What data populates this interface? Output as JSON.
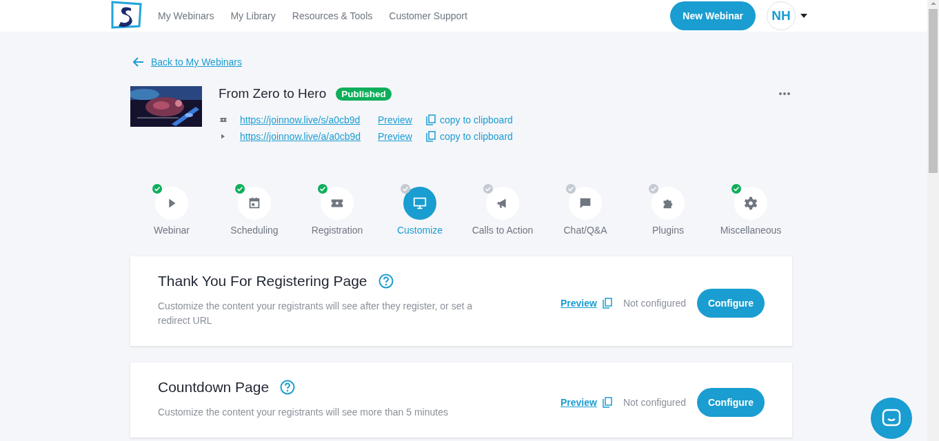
{
  "header": {
    "nav": [
      {
        "label": "My Webinars"
      },
      {
        "label": "My Library"
      },
      {
        "label": "Resources & Tools"
      },
      {
        "label": "Customer Support"
      }
    ],
    "new_button": "New Webinar",
    "avatar": "NH"
  },
  "back_link": "Back to My Webinars",
  "webinar": {
    "title": "From Zero to Hero",
    "status": "Published",
    "links": [
      {
        "kind": "registration",
        "url": "https://joinnow.live/s/a0cb9d",
        "preview": "Preview",
        "copy": "copy to clipboard"
      },
      {
        "kind": "attendee",
        "url": "https://joinnow.live/a/a0cb9d",
        "preview": "Preview",
        "copy": "copy to clipboard"
      }
    ]
  },
  "steps": [
    {
      "kind": "play",
      "label": "Webinar",
      "done": true,
      "selected": false
    },
    {
      "kind": "calendar",
      "label": "Scheduling",
      "done": true,
      "selected": false
    },
    {
      "kind": "ticket",
      "label": "Registration",
      "done": true,
      "selected": false
    },
    {
      "kind": "monitor",
      "label": "Customize",
      "done": false,
      "selected": true
    },
    {
      "kind": "megaphone",
      "label": "Calls to Action",
      "done": false,
      "selected": false
    },
    {
      "kind": "chat",
      "label": "Chat/Q&A",
      "done": false,
      "selected": false
    },
    {
      "kind": "puzzle",
      "label": "Plugins",
      "done": false,
      "selected": false
    },
    {
      "kind": "gear",
      "label": "Miscellaneous",
      "done": true,
      "selected": false
    }
  ],
  "cards": [
    {
      "title": "Thank You For Registering Page",
      "description": "Customize the content your registrants will see after they register, or set a redirect URL",
      "preview": "Preview",
      "status": "Not configured",
      "button": "Configure"
    },
    {
      "title": "Countdown Page",
      "description": "Customize the content your registrants will see more than 5 minutes",
      "preview": "Preview",
      "status": "Not configured",
      "button": "Configure"
    }
  ]
}
